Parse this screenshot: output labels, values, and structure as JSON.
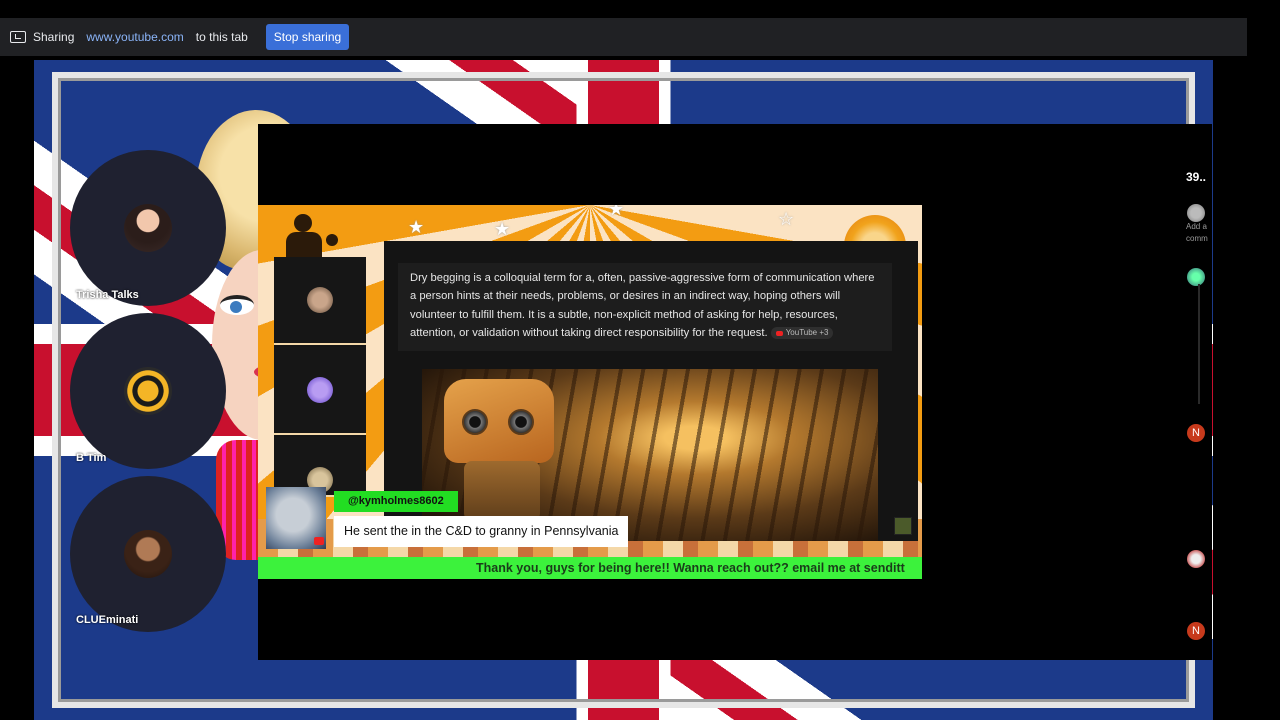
{
  "share_bar": {
    "label": "Sharing",
    "url": "www.youtube.com",
    "suffix": "to this tab",
    "stop_label": "Stop sharing"
  },
  "participants": [
    {
      "name": "Trisha Talks"
    },
    {
      "name": "B Tim"
    },
    {
      "name": "CLUEminati"
    }
  ],
  "stream": {
    "quote": "Dry begging is a colloquial term for a, often, passive-aggressive form of communication where a person hints at their needs, problems, or desires in an indirect way, hoping others will volunteer to fulfill them. It is a subtle, non-explicit method of asking for help, resources, attention, or validation without taking direct responsibility for the request.",
    "source_chip": "YouTube +3",
    "chat_user": "@kymholmes8602",
    "chat_message": "He sent the in the C&D to granny in Pennsylvania",
    "ticker": "Thank you, guys for being here!! Wanna reach out?? email me at senditt"
  },
  "comment_rail": {
    "count": "39..",
    "add_comment": "Add a comm",
    "badges": [
      "N",
      "N"
    ]
  },
  "colors": {
    "share_bar_bg": "#202124",
    "stop_button": "#3a6fd8",
    "url_link": "#8ab4f8",
    "chat_user_bg": "#22dd22",
    "ticker_bg": "#3cf23c",
    "rail_badge": "#c73a1c"
  }
}
